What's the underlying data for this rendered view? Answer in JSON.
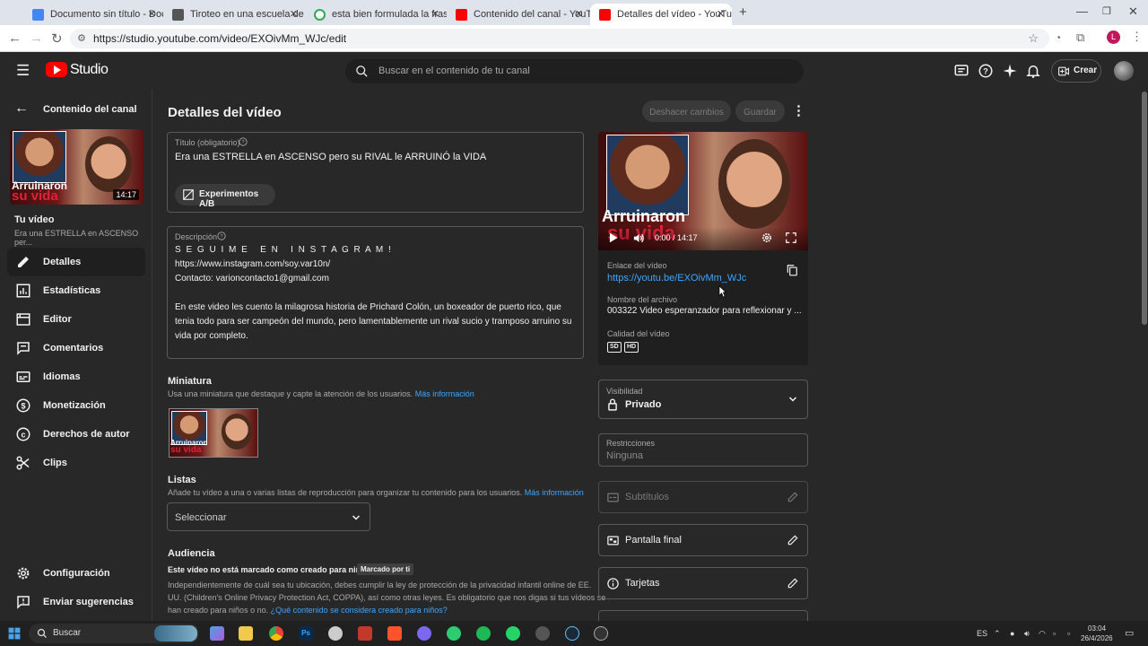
{
  "browser": {
    "tabs": [
      {
        "title": "Documento sin título - Docum",
        "color": "#4285f4"
      },
      {
        "title": "Tiroteo en una escuela de Sant",
        "color": "#555555"
      },
      {
        "title": "esta bien formulada la frase Po",
        "color": "#34a853"
      },
      {
        "title": "Contenido del canal - YouTube",
        "color": "#ff0000"
      },
      {
        "title": "Detalles del vídeo - YouTube St",
        "color": "#ff0000"
      }
    ],
    "new_tab": "+",
    "url": "https://studio.youtube.com/video/EXOivMm_WJc/edit",
    "profile_initial": "L"
  },
  "header": {
    "logo": "Studio",
    "search_placeholder": "Buscar en el contenido de tu canal",
    "create_label": "Crear"
  },
  "sidebar": {
    "back_label": "Contenido del canal",
    "duration": "14:17",
    "your_video": "Tu vídeo",
    "video_title_short": "Era una ESTRELLA en ASCENSO per...",
    "items": [
      {
        "label": "Detalles",
        "icon": "pencil-icon"
      },
      {
        "label": "Estadísticas",
        "icon": "analytics-icon"
      },
      {
        "label": "Editor",
        "icon": "editor-icon"
      },
      {
        "label": "Comentarios",
        "icon": "comments-icon"
      },
      {
        "label": "Idiomas",
        "icon": "subtitles-icon"
      },
      {
        "label": "Monetización",
        "icon": "dollar-icon"
      },
      {
        "label": "Derechos de autor",
        "icon": "copyright-icon"
      },
      {
        "label": "Clips",
        "icon": "scissors-icon"
      }
    ],
    "settings_label": "Configuración",
    "feedback_label": "Enviar sugerencias"
  },
  "thumb_text": {
    "line1": "Arruinaron",
    "line2": "su vida"
  },
  "main": {
    "page_title": "Detalles del vídeo",
    "undo_label": "Deshacer cambios",
    "save_label": "Guardar",
    "title_label": "Título (obligatorio)",
    "title_value": "Era una ESTRELLA en ASCENSO pero su RIVAL le ARRUINÓ la VIDA",
    "ab_label": "Experimentos A/B",
    "desc_label": "Descripción",
    "desc_lines": [
      "S E G U I M E   E N   I N S T A G R A M !",
      "https://www.instagram.com/soy.var10n/",
      "Contacto: varioncontacto1@gmail.com",
      "",
      "En este video les cuento la milagrosa historia de Prichard Colón, un boxeador de puerto rico, que",
      "tenia todo para ser campeón del mundo, pero lamentablemente un rival sucio y tramposo arruino su",
      "vida por completo."
    ],
    "thumbnail_title": "Miniatura",
    "thumbnail_sub": "Usa una miniatura que destaque y capte la atención de los usuarios.",
    "more_info": "Más información",
    "lists_title": "Listas",
    "lists_sub": "Añade tu vídeo a una o varias listas de reproducción para organizar tu contenido para los usuarios.",
    "lists_select": "Seleccionar",
    "audience_title": "Audiencia",
    "audience_status": "Este vídeo no está marcado como creado para niños",
    "audience_badge": "Marcado por ti",
    "audience_text1": "Independientemente de cuál sea tu ubicación, debes cumplir la ley de protección de la privacidad infantil online de EE.",
    "audience_text2": "UU. (Children's Online Privacy Protection Act, COPPA), así como otras leyes. Es obligatorio que nos digas si tus vídeos se",
    "audience_text3": "han creado para niños o no.",
    "audience_link": "¿Qué contenido se considera creado para niños?"
  },
  "player": {
    "time": "0:00 / 14:17",
    "link_label": "Enlace del vídeo",
    "link_value": "https://youtu.be/EXOivMm_WJc",
    "file_label": "Nombre del archivo",
    "file_value": "003322 Video esperanzador para reflexionar y ...",
    "quality_label": "Calidad del vídeo",
    "q1": "SD",
    "q2": "HD"
  },
  "right": {
    "visibility_label": "Visibilidad",
    "visibility_value": "Privado",
    "restrictions_label": "Restricciones",
    "restrictions_value": "Ninguna",
    "subtitles": "Subtítulos",
    "end_screen": "Pantalla final",
    "cards": "Tarjetas"
  },
  "taskbar": {
    "search": "Buscar",
    "lang": "ES",
    "time": "03:04",
    "date": "26/4/2026"
  }
}
